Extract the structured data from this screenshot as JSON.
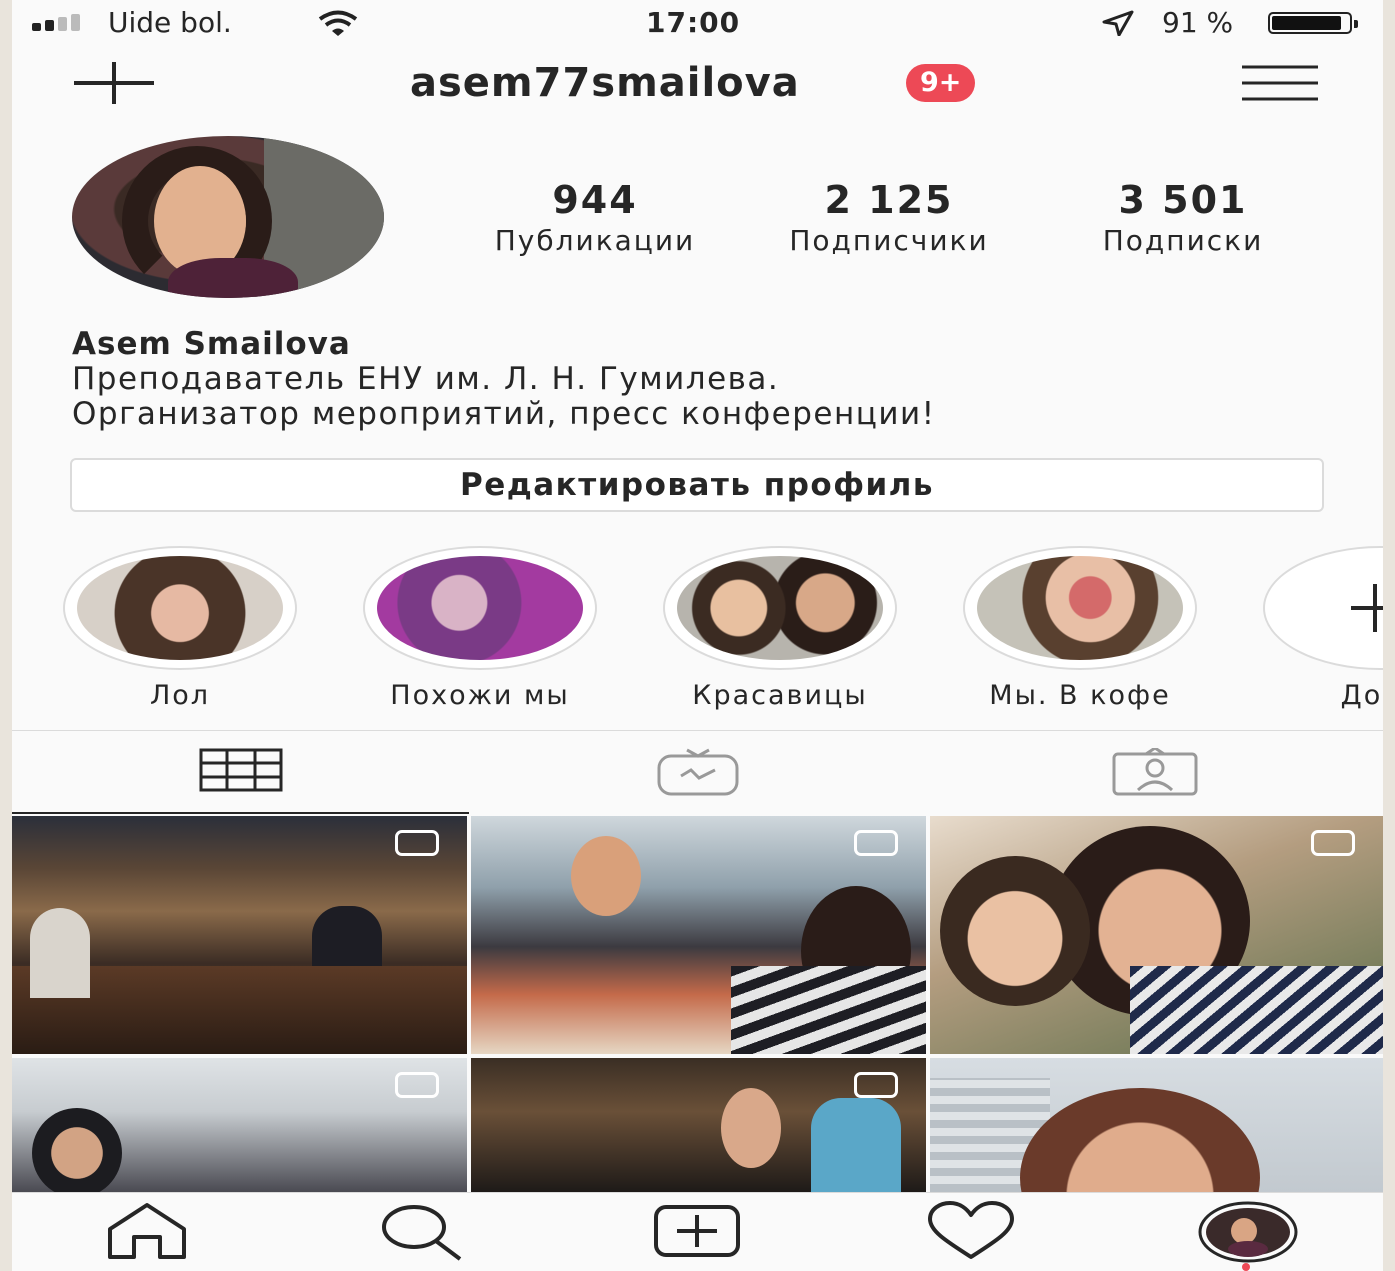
{
  "status_bar": {
    "carrier": "Uide bol.",
    "time": "17:00",
    "battery_percent": "91 %",
    "battery_level": 0.91,
    "signal_bars": 4,
    "signal_active": 2
  },
  "header": {
    "username": "asem77smailova",
    "notification_badge": "9+"
  },
  "stats": [
    {
      "value": "944",
      "label": "Публикации"
    },
    {
      "value": "2 125",
      "label": "Подписчики"
    },
    {
      "value": "3 501",
      "label": "Подписки"
    }
  ],
  "profile": {
    "name": "Asem Smailova",
    "bio_line1": "Преподаватель ЕНУ им. Л. Н. Гумилева.",
    "bio_line2": "Организатор мероприятий, пресс конференции!",
    "edit_button": "Редактировать профиль"
  },
  "highlights": [
    {
      "label": "Лол"
    },
    {
      "label": "Похожи мы"
    },
    {
      "label": "Красавицы"
    },
    {
      "label": "Мы. В  кофе"
    },
    {
      "label": "Доба"
    }
  ],
  "tabs": [
    "grid",
    "igtv",
    "tagged"
  ],
  "colors": {
    "badge": "#ed4956",
    "text": "#262626",
    "border": "#dbdbdb"
  }
}
